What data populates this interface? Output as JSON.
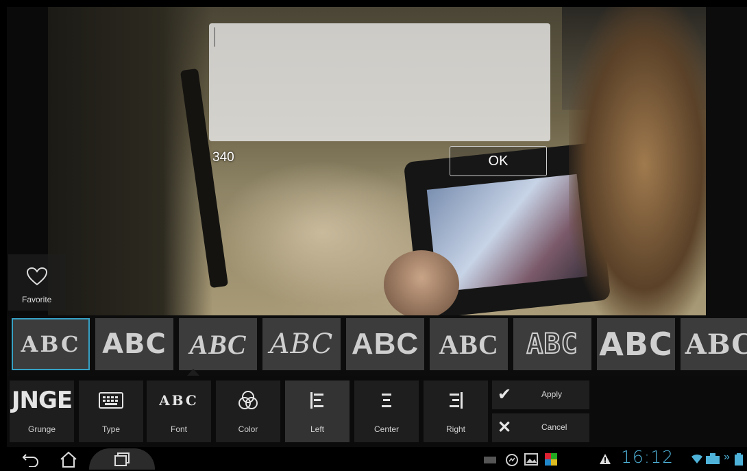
{
  "dialog": {
    "text_value": "",
    "char_count": "340",
    "ok_label": "OK"
  },
  "favorite": {
    "label": "Favorite",
    "icon": "heart-outline-icon"
  },
  "font_strip": {
    "tiles": [
      {
        "sample": "ABC",
        "selected": true
      },
      {
        "sample": "ABC",
        "selected": false
      },
      {
        "sample": "ABC",
        "selected": false
      },
      {
        "sample": "ABC",
        "selected": false
      },
      {
        "sample": "ABC",
        "selected": false
      },
      {
        "sample": "ABC",
        "selected": false
      },
      {
        "sample": "ABC",
        "selected": false
      },
      {
        "sample": "ABC",
        "selected": false
      },
      {
        "sample": "ABC",
        "selected": false
      }
    ]
  },
  "toolbar": {
    "grunge": {
      "label": "Grunge",
      "preview": "JNGE"
    },
    "type": {
      "label": "Type",
      "icon": "keyboard-icon"
    },
    "font": {
      "label": "Font",
      "preview": "ABC"
    },
    "color": {
      "label": "Color",
      "icon": "color-circles-icon"
    },
    "left": {
      "label": "Left",
      "icon": "align-left-icon"
    },
    "center": {
      "label": "Center",
      "icon": "align-center-icon"
    },
    "right": {
      "label": "Right",
      "icon": "align-right-icon"
    },
    "apply": {
      "label": "Apply",
      "icon": "check-icon"
    },
    "cancel": {
      "label": "Cancel",
      "icon": "x-icon"
    }
  },
  "system_bar": {
    "clock": "16:12",
    "accent": "#4fb3d9"
  }
}
